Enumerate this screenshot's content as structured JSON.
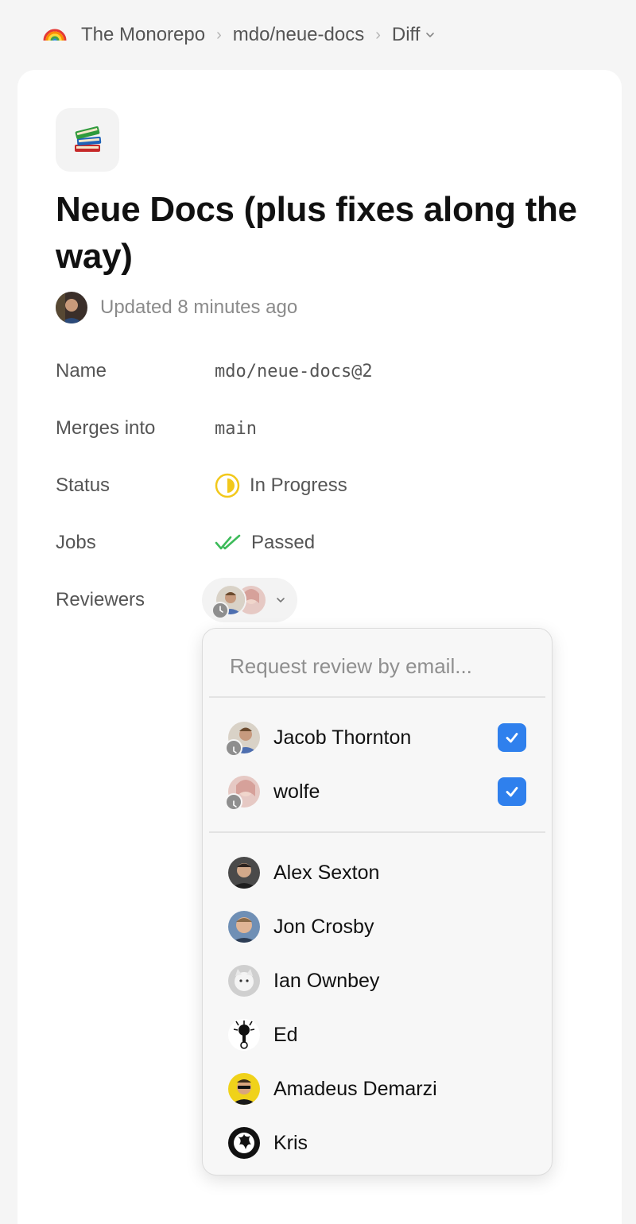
{
  "breadcrumb": {
    "icon": "rainbow-icon",
    "items": [
      "The Monorepo",
      "mdo/neue-docs",
      "Diff"
    ]
  },
  "diff": {
    "icon": "books-icon",
    "title": "Neue Docs (plus fixes along the way)",
    "updated": "Updated 8 minutes ago"
  },
  "properties": {
    "name_label": "Name",
    "name_value": "mdo/neue-docs@2",
    "merges_label": "Merges into",
    "merges_value": "main",
    "status_label": "Status",
    "status_value": "In Progress",
    "jobs_label": "Jobs",
    "jobs_value": "Passed",
    "reviewers_label": "Reviewers"
  },
  "reviewer_dropdown": {
    "search_placeholder": "Request review by email...",
    "requested": [
      {
        "name": "Jacob Thornton",
        "checked": true
      },
      {
        "name": "wolfe",
        "checked": true
      }
    ],
    "others": [
      {
        "name": "Alex Sexton"
      },
      {
        "name": "Jon Crosby"
      },
      {
        "name": "Ian Ownbey"
      },
      {
        "name": "Ed"
      },
      {
        "name": "Amadeus Demarzi"
      },
      {
        "name": "Kris"
      }
    ]
  },
  "colors": {
    "accent": "#2f80ed",
    "status_in_progress": "#f2c81b",
    "jobs_passed": "#3dbb5a"
  }
}
